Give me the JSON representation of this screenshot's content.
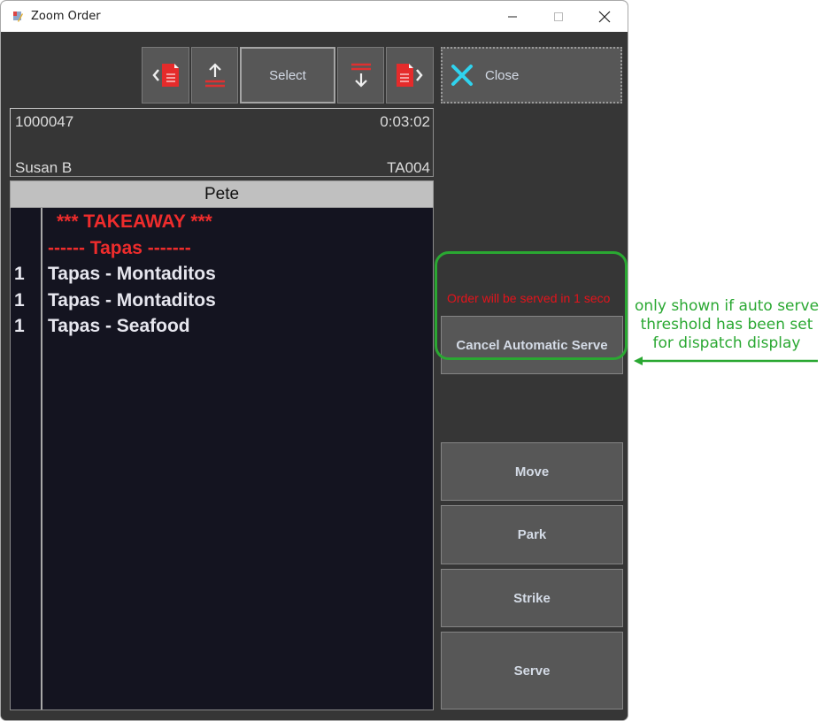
{
  "window": {
    "title": "Zoom Order",
    "controls": {
      "minimize": "minimize-icon",
      "maximize": "maximize-icon",
      "close": "close-icon"
    }
  },
  "toolbar": {
    "prev_order_icon": "previous-document-icon",
    "scroll_up_icon": "scroll-up-icon",
    "select_label": "Select",
    "scroll_down_icon": "scroll-down-icon",
    "next_order_icon": "next-document-icon",
    "close_label": "Close"
  },
  "order": {
    "number": "1000047",
    "elapsed": "0:03:02",
    "staff": "Susan B",
    "table": "TA004",
    "server": "Pete"
  },
  "lines": [
    {
      "qty": "",
      "text": "*** TAKEAWAY ***",
      "style": "red",
      "indent": true
    },
    {
      "qty": "",
      "text": "------ Tapas -------",
      "style": "red",
      "indent": false
    },
    {
      "qty": "1",
      "text": "Tapas - Montaditos",
      "style": "normal",
      "indent": false
    },
    {
      "qty": "1",
      "text": "Tapas - Montaditos",
      "style": "normal",
      "indent": false
    },
    {
      "qty": "1",
      "text": "Tapas - Seafood",
      "style": "normal",
      "indent": false
    }
  ],
  "auto_serve": {
    "message": "Order will be served in 1 seco",
    "cancel_label": "Cancel Automatic Serve"
  },
  "actions": {
    "move": "Move",
    "park": "Park",
    "strike": "Strike",
    "serve": "Serve"
  },
  "annotation": {
    "text": "only shown if auto serve threshold has been set for dispatch display",
    "line1": "only shown if auto serve",
    "line2": "threshold has been set",
    "line3": "for dispatch display",
    "color": "#2aa832"
  },
  "colors": {
    "accent_red": "#ee2c2c",
    "close_x": "#2fd3ee",
    "button_bg": "#575757",
    "list_bg": "#141420"
  }
}
